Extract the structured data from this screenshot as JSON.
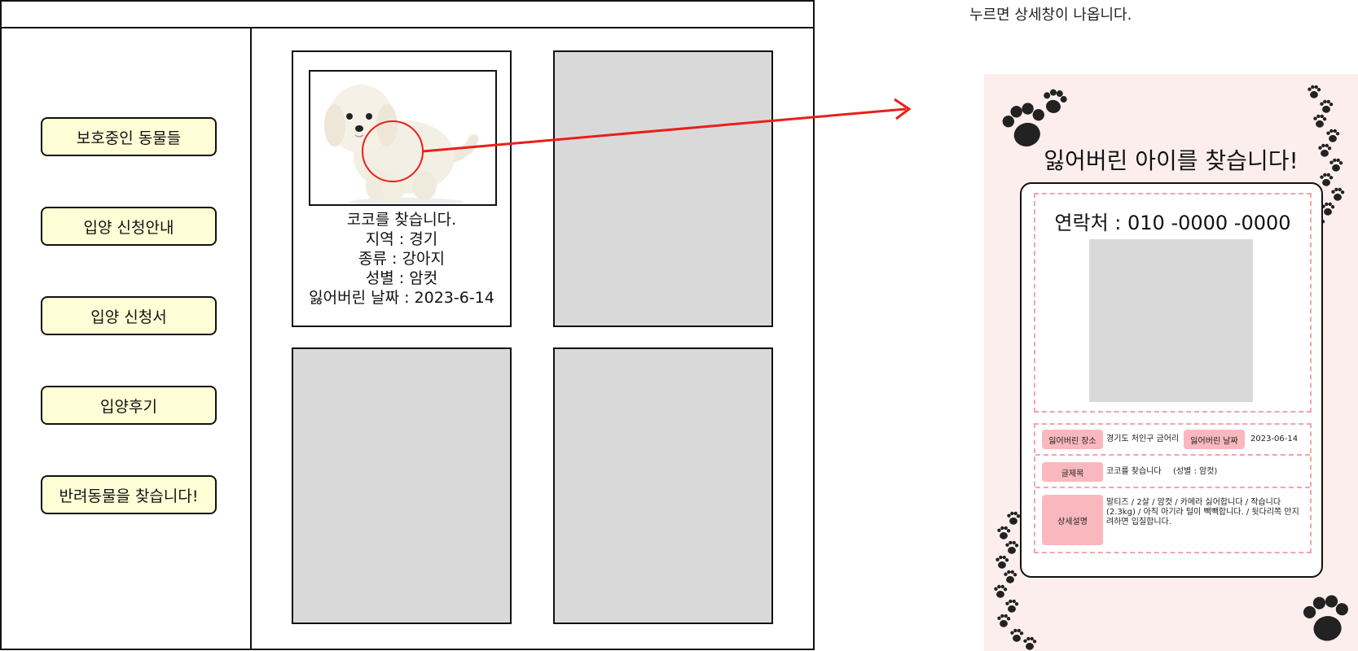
{
  "sidebar": {
    "items": [
      {
        "label": "보호중인 동물들"
      },
      {
        "label": "입양 신청안내"
      },
      {
        "label": "입양 신청서"
      },
      {
        "label": "입양후기"
      },
      {
        "label": "반려동물을 찾습니다!"
      }
    ]
  },
  "card": {
    "lines": [
      "코코를 찾습니다.",
      "지역 : 경기",
      "종류 : 강아지",
      "성별 : 암컷",
      "잃어버린 날짜 : 2023-6-14"
    ]
  },
  "annotation": {
    "caption": "누르면 상세창이 나옵니다.",
    "arrow_color": "#e8201a"
  },
  "detail": {
    "title": "잃어버린 아이를 찾습니다!",
    "contact": "연락처 : 010 -0000 -0000",
    "lost_place_label": "잃어버린 장소",
    "lost_place_value": "경기도 처인구 금어리",
    "lost_date_label": "잃어버린 날짜",
    "lost_date_value": "2023-06-14",
    "subject_label": "글제목",
    "subject_value": "코코를 찾습니다",
    "gender_value": "(성별 : 암컷)",
    "desc_label": "상세설명",
    "desc_value": "말티즈 / 2살 / 암컷 / 카메라 싫어합니다 / 작습니다 (2.3kg) / 아직 아기라 털이 빽빽합니다. / 뒷다리쪽 만지려하면 입질합니다."
  },
  "colors": {
    "menu_fill": "#fffed6",
    "placeholder": "#d9d9d9",
    "poster_bg": "#fdeeee",
    "pink_label": "#f8b8bd",
    "dash": "#f2a5ad"
  }
}
